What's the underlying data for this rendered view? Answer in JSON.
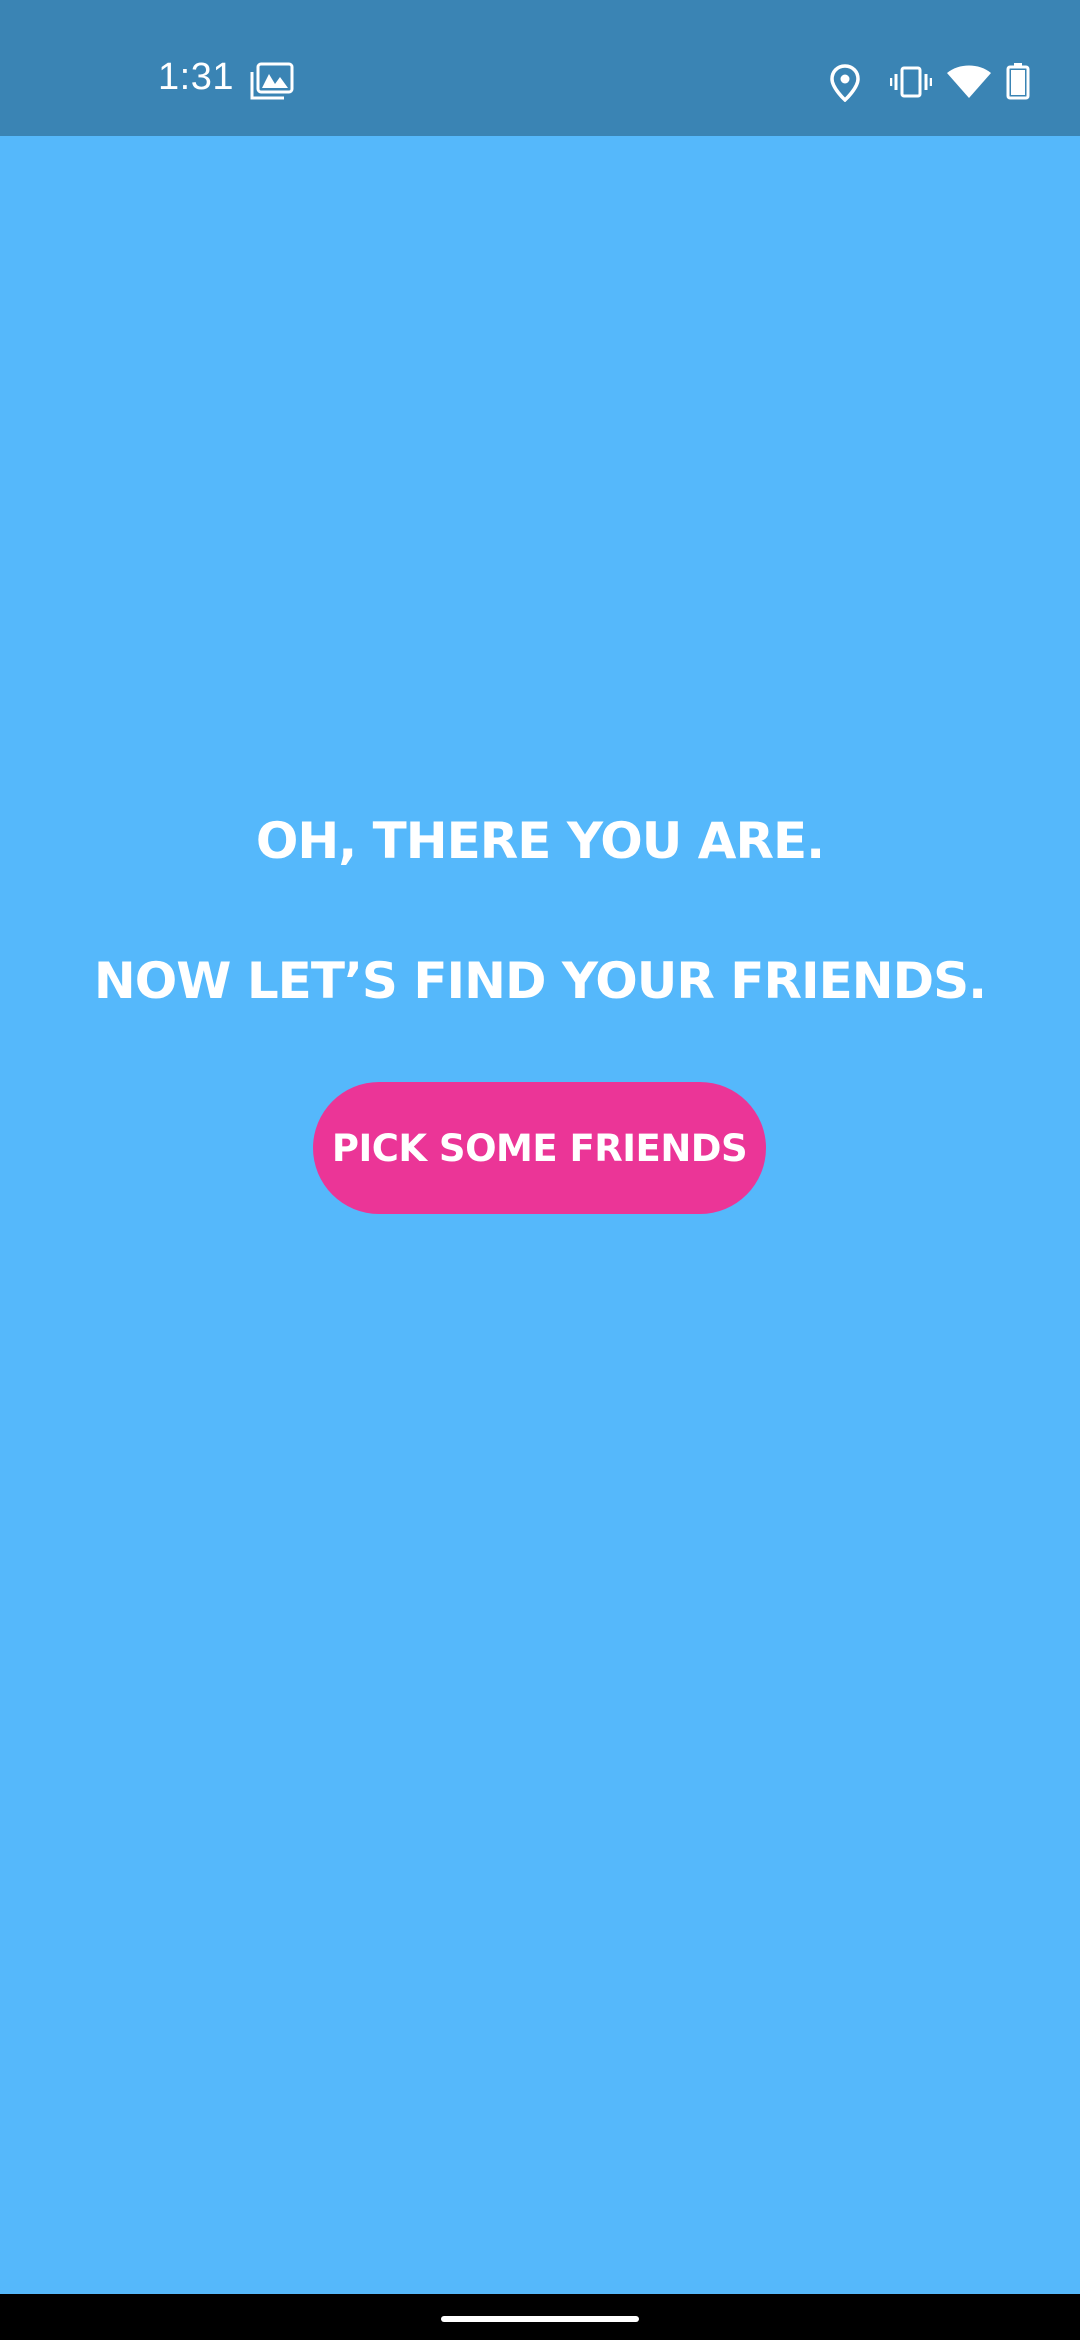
{
  "status_bar": {
    "time": "1:31",
    "icons": [
      "gallery-notification-icon",
      "location-icon",
      "vibrate-icon",
      "wifi-icon",
      "battery-icon"
    ],
    "background": "#3a84b4"
  },
  "main": {
    "headline_1": "OH, THERE YOU ARE.",
    "headline_2": "NOW LET’S FIND YOUR FRIENDS.",
    "cta_label": "PICK SOME FRIENDS",
    "background": "#55b8fb",
    "cta_color": "#eb3597"
  },
  "nav_bar": {
    "handle": "home-handle"
  }
}
